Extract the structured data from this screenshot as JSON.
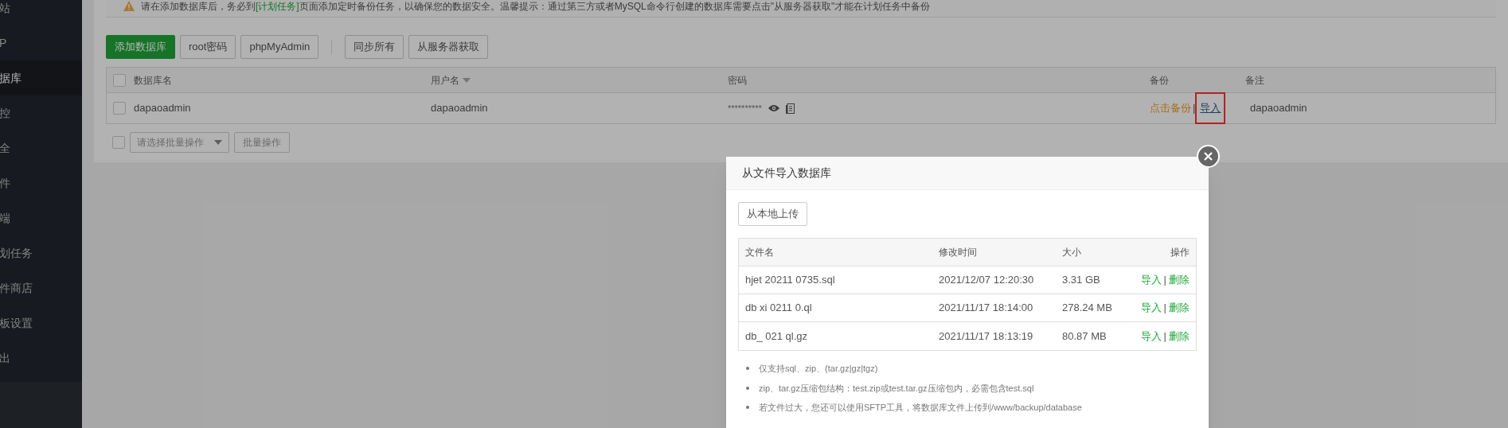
{
  "sidebar": {
    "items": [
      {
        "label": "站",
        "selected": false
      },
      {
        "label": "P",
        "selected": false
      },
      {
        "label": "据库",
        "selected": true
      },
      {
        "label": "控",
        "selected": false
      },
      {
        "label": "全",
        "selected": false
      },
      {
        "label": "件",
        "selected": false
      },
      {
        "label": "端",
        "selected": false
      },
      {
        "label": "划任务",
        "selected": false
      },
      {
        "label": "件商店",
        "selected": false
      },
      {
        "label": "板设置",
        "selected": false
      },
      {
        "label": "出",
        "selected": false
      }
    ]
  },
  "notice": {
    "before": "请在添加数据库后，务必到",
    "link": "[计划任务]",
    "after": "页面添加定时备份任务，以确保您的数据安全。温馨提示：通过第三方或者MySQL命令行创建的数据库需要点击\"从服务器获取\"才能在计划任务中备份"
  },
  "toolbar": {
    "left": [
      {
        "label": "添加数据库",
        "kind": "primary"
      },
      {
        "label": "root密码",
        "kind": "default"
      },
      {
        "label": "phpMyAdmin",
        "kind": "default"
      }
    ],
    "right": [
      {
        "label": "同步所有",
        "kind": "default"
      },
      {
        "label": "从服务器获取",
        "kind": "default"
      }
    ]
  },
  "table": {
    "header_checked": false,
    "columns": [
      {
        "label": "数据库名",
        "sortable": false
      },
      {
        "label": "用户名",
        "sortable": true
      },
      {
        "label": "密码",
        "sortable": false
      },
      {
        "label": "备份",
        "sortable": false
      },
      {
        "label": "备注",
        "sortable": false
      }
    ],
    "rows": [
      {
        "checked": false,
        "name": "dapaoadmin",
        "user": "dapaoadmin",
        "password": "**********",
        "backup": "点击备份",
        "separator": "|",
        "import": "导入",
        "import_highlighted": true,
        "note": "dapaoadmin"
      }
    ]
  },
  "batch": {
    "checked": false,
    "select_placeholder": "请选择批量操作",
    "button": "批量操作"
  },
  "modal": {
    "title": "从文件导入数据库",
    "upload_button": "从本地上传",
    "columns": [
      "文件名",
      "修改时间",
      "大小",
      "操作"
    ],
    "files": [
      {
        "name": "hjet 20211 0735.sql",
        "modified": "2021/12/07 12:20:30",
        "size": "3.31 GB",
        "import": "导入",
        "separator": "|",
        "delete": "删除"
      },
      {
        "name": "db xi 0211 0.ql",
        "modified": "2021/11/17 18:14:00",
        "size": "278.24 MB",
        "import": "导入",
        "separator": "|",
        "delete": "删除"
      },
      {
        "name": "db_ 021 ql.gz",
        "modified": "2021/11/17 18:13:19",
        "size": "80.87 MB",
        "import": "导入",
        "separator": "|",
        "delete": "删除"
      }
    ],
    "notes": [
      "仅支持sql、zip、(tar.gz|gz|tgz)",
      "zip、tar.gz压缩包结构：test.zip或test.tar.gz压缩包内，必需包含test.sql",
      "若文件过大，您还可以使用SFTP工具，将数据库文件上传到/www/backup/database"
    ]
  }
}
